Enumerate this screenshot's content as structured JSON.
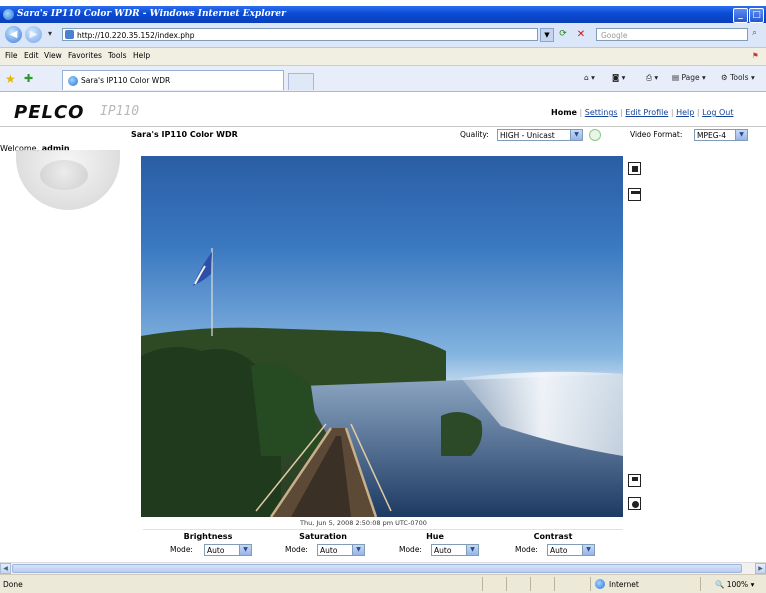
{
  "window": {
    "title": "Sara's IP110 Color WDR - Windows Internet Explorer",
    "controls": [
      "_",
      "□"
    ]
  },
  "address": {
    "url": "http://10.220.35.152/index.php",
    "search_placeholder": "Google"
  },
  "menu": [
    "File",
    "Edit",
    "View",
    "Favorites",
    "Tools",
    "Help"
  ],
  "tab": {
    "title": "Sara's IP110 Color WDR"
  },
  "commands": {
    "page": "Page",
    "tools": "Tools"
  },
  "page": {
    "brand": "PELCO",
    "model": "IP110",
    "nav": [
      "Home",
      "Settings",
      "Edit Profile",
      "Help",
      "Log Out"
    ],
    "camera_name": "Sara's IP110 Color WDR",
    "quality_label": "Quality:",
    "quality_value": "HIGH - Unicast",
    "video_format_label": "Video Format:",
    "video_format_value": "MPEG-4",
    "welcome_text": "Welcome,",
    "username": "admin",
    "timestamp": "Thu, Jun 5, 2008 2:50:08 pm UTC-0700",
    "controls": [
      {
        "title": "Brightness",
        "mode_label": "Mode:",
        "mode_value": "Auto"
      },
      {
        "title": "Saturation",
        "mode_label": "Mode:",
        "mode_value": "Auto"
      },
      {
        "title": "Hue",
        "mode_label": "Mode:",
        "mode_value": "Auto"
      },
      {
        "title": "Contrast",
        "mode_label": "Mode:",
        "mode_value": "Auto"
      }
    ]
  },
  "status": {
    "text": "Done",
    "zone": "Internet",
    "zoom": "100%"
  }
}
